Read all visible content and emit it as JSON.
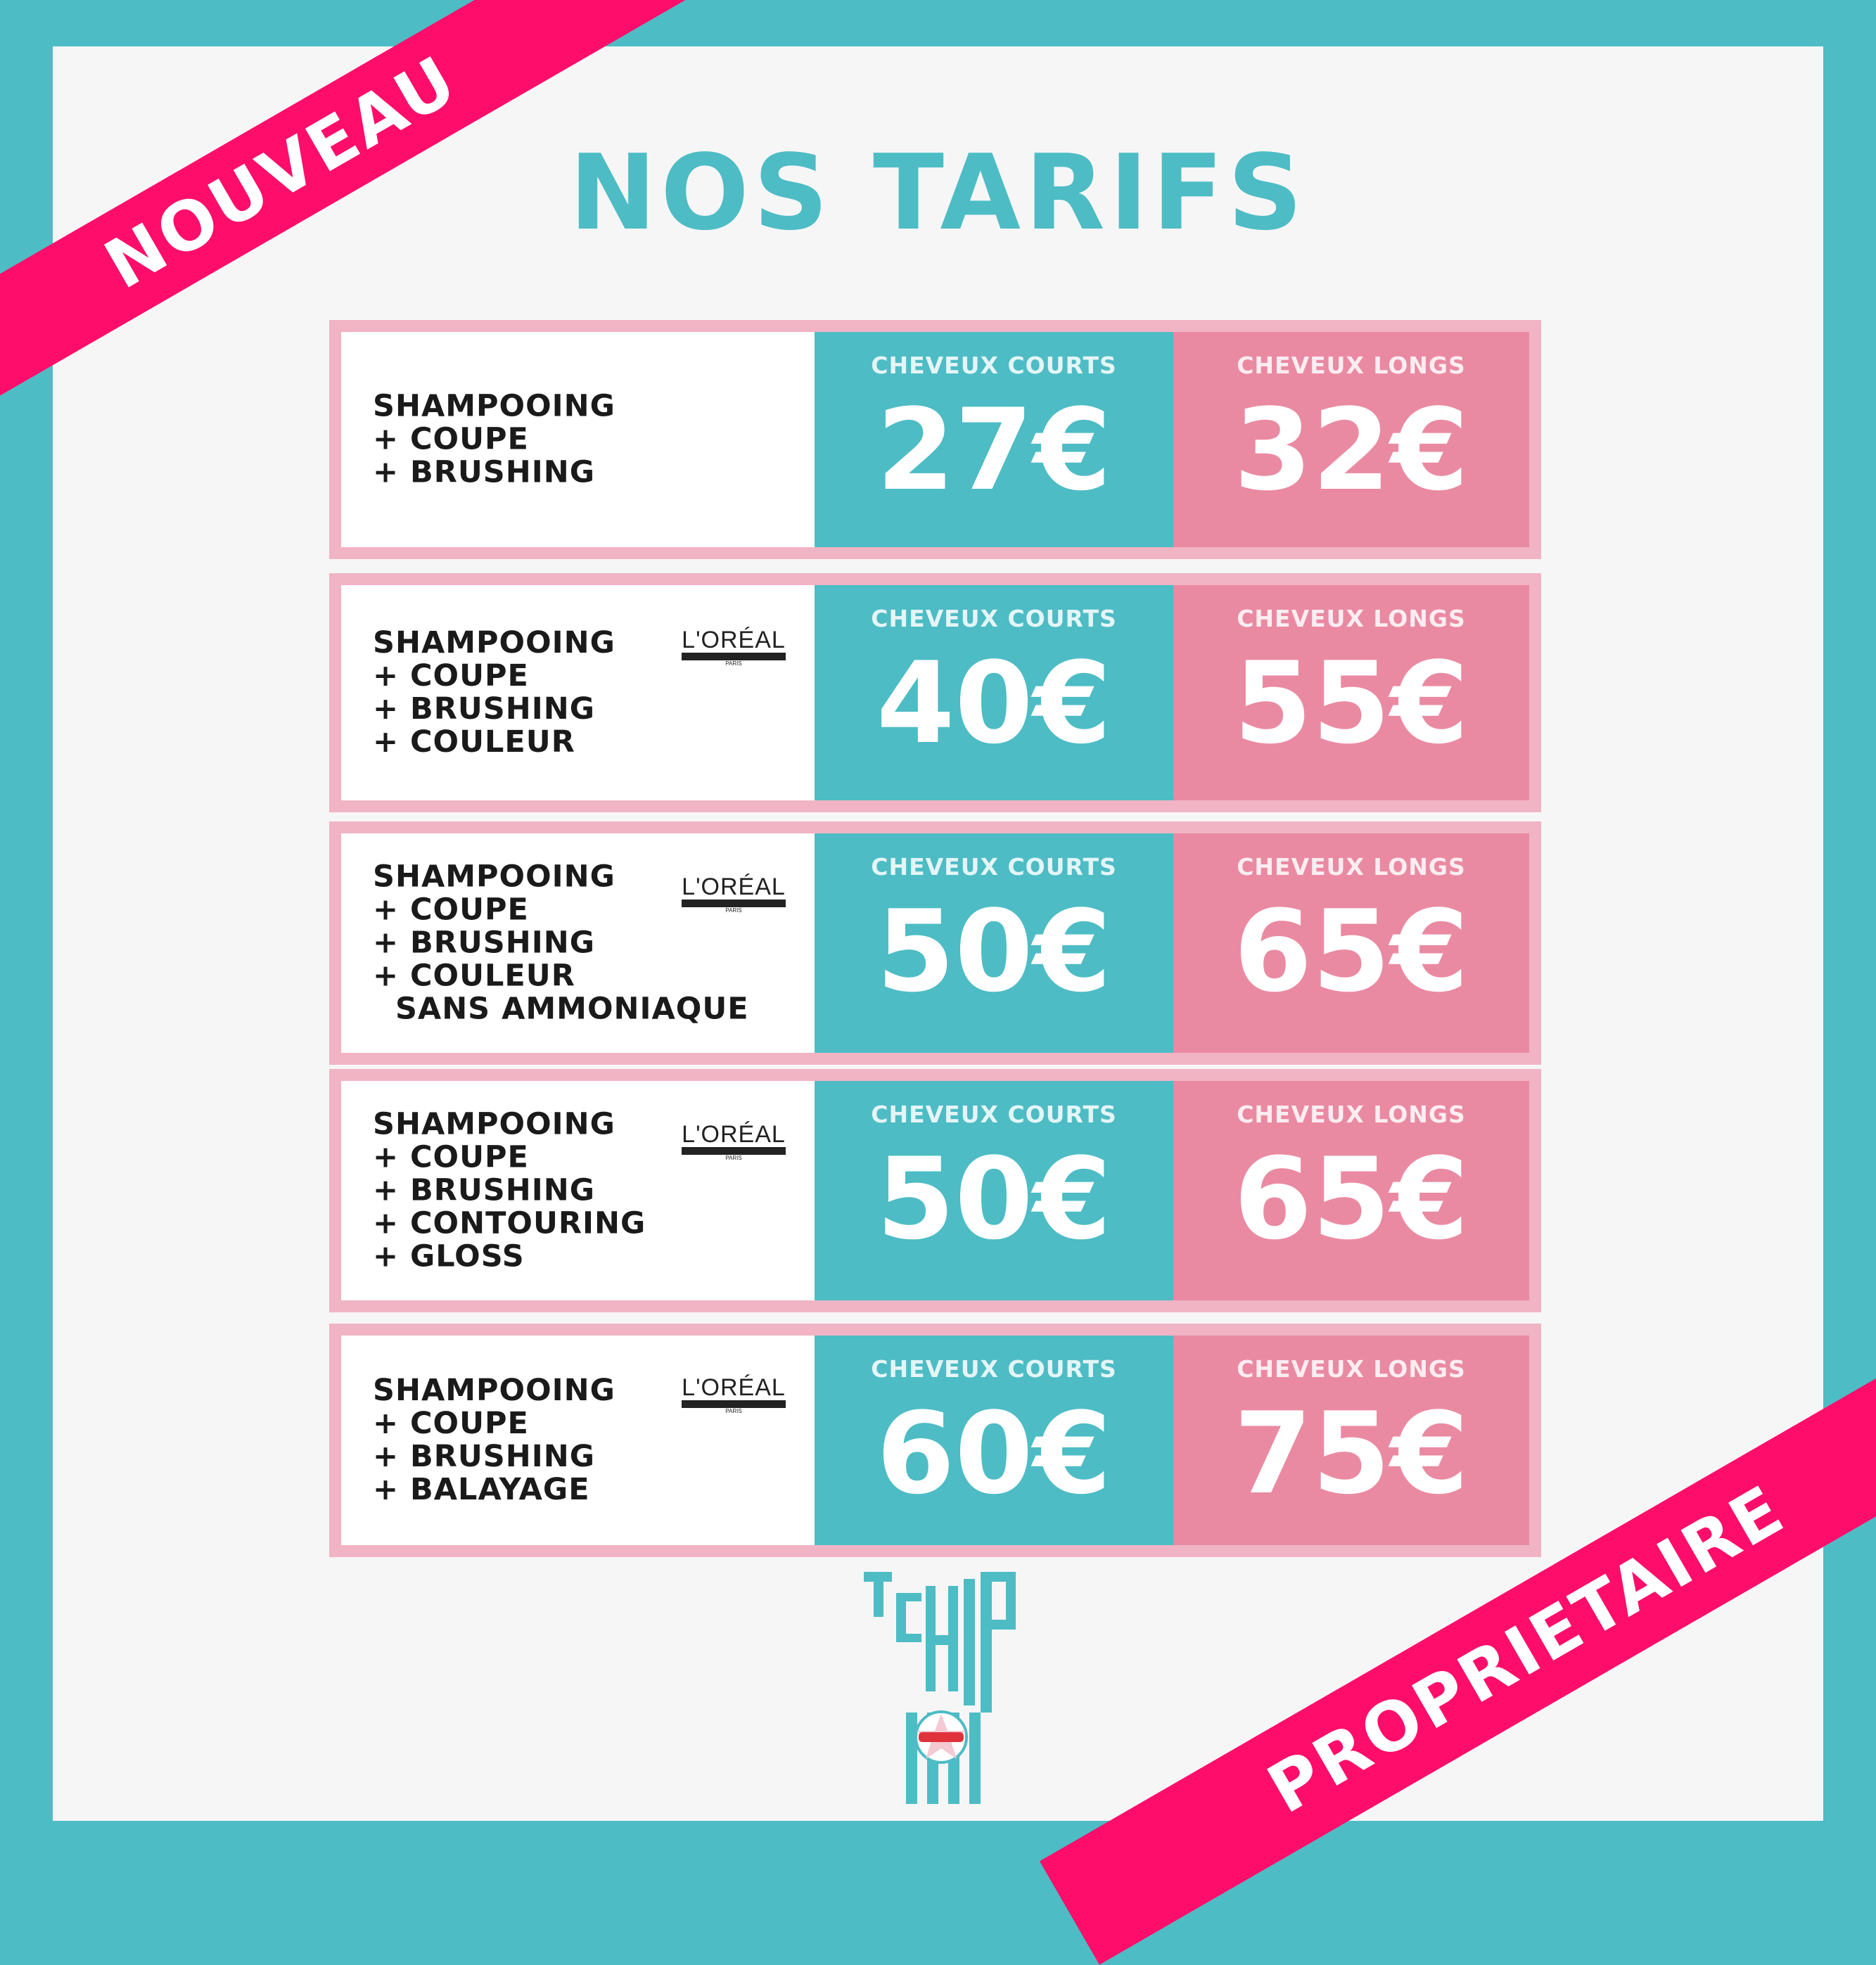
{
  "title": "NOS TARIFS",
  "banners": {
    "top_left": "NOUVEAU",
    "bottom_right": "PROPRIETAIRE"
  },
  "brand_logo": {
    "text": "L'ORÉAL",
    "sub": "PROFESSIONNEL",
    "city": "PARIS"
  },
  "footer_logo": {
    "text": "TCHIP"
  },
  "rows": [
    {
      "lines": [
        "SHAMPOOING",
        "+ COUPE",
        "+ BRUSHING"
      ],
      "loreal": false,
      "short_label": "CHEVEUX COURTS",
      "short_price": "27€",
      "long_label": "CHEVEUX LONGS",
      "long_price": "32€"
    },
    {
      "lines": [
        "SHAMPOOING",
        "+ COUPE",
        "+ BRUSHING",
        "+ COULEUR"
      ],
      "loreal": true,
      "short_label": "CHEVEUX COURTS",
      "short_price": "40€",
      "long_label": "CHEVEUX LONGS",
      "long_price": "55€"
    },
    {
      "lines": [
        "SHAMPOOING",
        "+ COUPE",
        "+ BRUSHING",
        "+ COULEUR",
        "  SANS AMMONIAQUE"
      ],
      "loreal": true,
      "short_label": "CHEVEUX COURTS",
      "short_price": "50€",
      "long_label": "CHEVEUX LONGS",
      "long_price": "65€"
    },
    {
      "lines": [
        "SHAMPOOING",
        "+ COUPE",
        "+ BRUSHING",
        "+ CONTOURING",
        "+ GLOSS"
      ],
      "loreal": true,
      "short_label": "CHEVEUX COURTS",
      "short_price": "50€",
      "long_label": "CHEVEUX LONGS",
      "long_price": "65€"
    },
    {
      "lines": [
        "SHAMPOOING",
        "+ COUPE",
        "+ BRUSHING",
        "+ BALAYAGE"
      ],
      "loreal": true,
      "short_label": "CHEVEUX COURTS",
      "short_price": "60€",
      "long_label": "CHEVEUX LONGS",
      "long_price": "75€"
    }
  ]
}
